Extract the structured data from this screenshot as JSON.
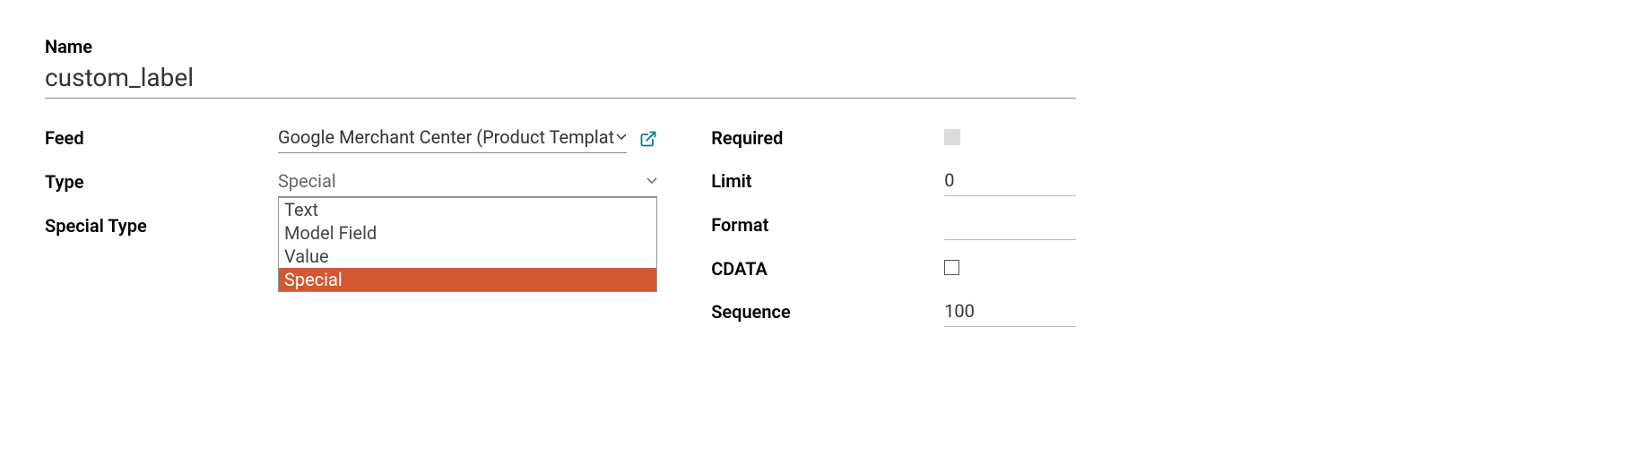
{
  "name": {
    "label": "Name",
    "value": "custom_label"
  },
  "feed": {
    "label": "Feed",
    "value": "Google Merchant Center (Product Templat"
  },
  "type": {
    "label": "Type",
    "value": "Special",
    "options": [
      "Text",
      "Model Field",
      "Value",
      "Special"
    ],
    "selected": "Special"
  },
  "special_type": {
    "label": "Special Type"
  },
  "required": {
    "label": "Required",
    "checked": false
  },
  "limit": {
    "label": "Limit",
    "value": "0"
  },
  "format": {
    "label": "Format",
    "value": ""
  },
  "cdata": {
    "label": "CDATA",
    "checked": false
  },
  "sequence": {
    "label": "Sequence",
    "value": "100"
  }
}
